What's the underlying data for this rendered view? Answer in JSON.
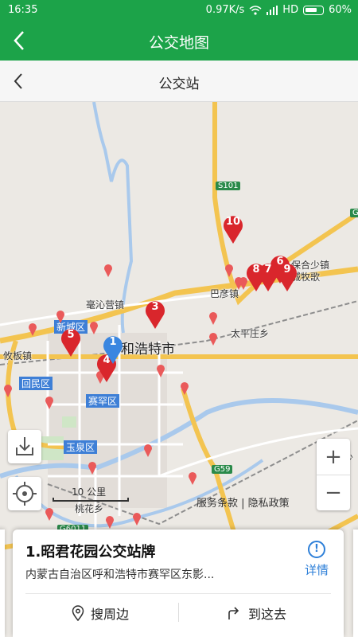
{
  "status": {
    "time": "16:35",
    "speed": "0.97K/s",
    "network": "HD",
    "battery": "60%"
  },
  "appbar": {
    "title": "公交地图"
  },
  "subbar": {
    "title": "公交站"
  },
  "map": {
    "place_labels": {
      "city": "和浩特市",
      "bayanzhen": "巴彦镇",
      "taipingzhuang": "太平庄乡",
      "haoqinying": "毫沁营镇",
      "xincheng": "新城区",
      "huimin": "回民区",
      "saihan": "赛罕区",
      "yuquan": "玉泉区",
      "youban": "攸板镇",
      "taohua": "桃花乡",
      "baohe": "保合少镇",
      "chengtuo": "城牧歌",
      "shaoside": "少"
    },
    "road_shields": {
      "s101": "S101",
      "g59": "G59",
      "g6": "G",
      "g6011": "G6011"
    },
    "markers": [
      "1",
      "3",
      "4",
      "5",
      "6",
      "7",
      "8",
      "9",
      "10"
    ],
    "scale_label": "10 公里",
    "legal": "服务条款 | 隐私政策",
    "zoom_in": "+",
    "zoom_out": "−"
  },
  "card": {
    "name": "1.昭君花园公交站牌",
    "address": "内蒙古自治区呼和浩特市赛罕区东影...",
    "detail_label": "详情",
    "nearby_label": "搜周边",
    "go_label": "到这去"
  },
  "colors": {
    "brand": "#1ca349",
    "pin": "#d9262c",
    "pin_selected": "#3a86e0",
    "link": "#2d7fd8"
  }
}
